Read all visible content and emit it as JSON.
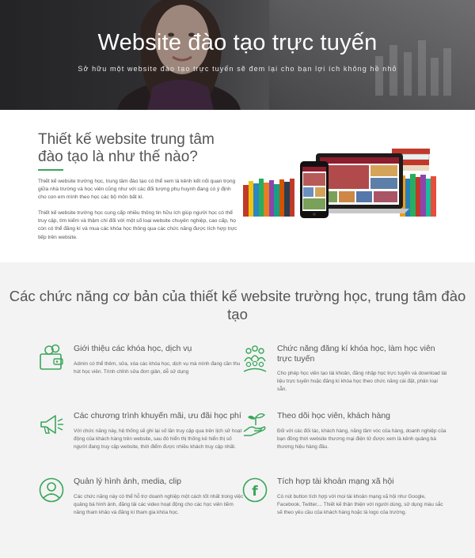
{
  "hero": {
    "title": "Website đào tạo trực tuyến",
    "subtitle": "Sở hữu một website đào tạo trực tuyến sẽ đem lại cho bạn lợi ích không hề nhỏ"
  },
  "intro": {
    "heading": "Thiết kế website trung tâm đào tạo là như thế nào?",
    "paragraph1": "Thiết kế website trường học, trung tâm đào tạo có thể xem là kênh kết nối quan trọng giữa nhà trường và học viên cũng như với các đối tượng phụ huynh đang có ý định cho con em mình theo học các bộ môn bất kì.",
    "paragraph2": "Thiết kế website trường học cung cấp nhiều thông tin hữu ích giúp người học có thể truy cập, tìm kiếm và thậm chí đối với một số loại website chuyên nghiệp, cao cấp, họ còn có thể đăng kí và mua các khóa học thông qua các chức năng được tích hợp trực tiếp trên website."
  },
  "features": {
    "heading": "Các chức năng cơ bản của thiết kế website trường học, trung tâm đào tạo",
    "accent_color": "#3aa65a",
    "items": [
      {
        "icon": "wallet-icon",
        "title": "Giới thiệu các khóa học, dịch vụ",
        "text": "Admin có thể thêm, sửa, xóa các khóa học, dịch vụ mà mình đang cần thu hút học viên. Trình chỉnh sửa đơn giản, dễ sử dụng"
      },
      {
        "icon": "group-icon",
        "title": "Chức năng đăng kí khóa học, làm học viên trực tuyến",
        "text": "Cho phép học viên tạo tài khoản, đăng nhập học trực tuyến và download tài liệu trực tuyến hoặc đăng kí khóa học theo chức năng cài đặt, phân loại sẵn."
      },
      {
        "icon": "megaphone-icon",
        "title": "Các chương trình khuyến mãi, ưu đãi học phí",
        "text": "Với chức năng này, hệ thống sẽ ghi lại số lần truy cập qua trên lịch sử hoạt động của khách hàng trên website, sau đó hiển thị thống kê hiển thị số người đang truy cập website, thời điểm được nhiều khách truy cập nhất."
      },
      {
        "icon": "hand-plant-icon",
        "title": "Theo dõi học viên, khách hàng",
        "text": "Đối với các đối tác, khách hàng, năng tầm vóc của hàng, doanh nghiệp của bạn đồng thời website thương mại điện tử được xem là kênh quảng bá thương hiệu hàng đầu."
      },
      {
        "icon": "person-circle-icon",
        "title": "Quản lý hình ảnh, media, clip",
        "text": "Các chức năng này có thể hỗ trợ doanh nghiệp một cách tốt nhất trong việc quảng bá hình ảnh, đăng tải các video hoạt động cho các học viên tiềm năng tham khảo và đăng kí tham gia khóa học."
      },
      {
        "icon": "facebook-icon",
        "title": "Tích hợp tài khoản mạng xã hội",
        "text": "Có nút button tích hợp với mọi tài khoản mạng xã hội như Google, Facebook, Twitter.... Thiết kế thân thiện với người dùng, sử dụng màu sắc sẽ theo yêu cầu của khách hàng hoặc là logo của trường."
      }
    ]
  }
}
